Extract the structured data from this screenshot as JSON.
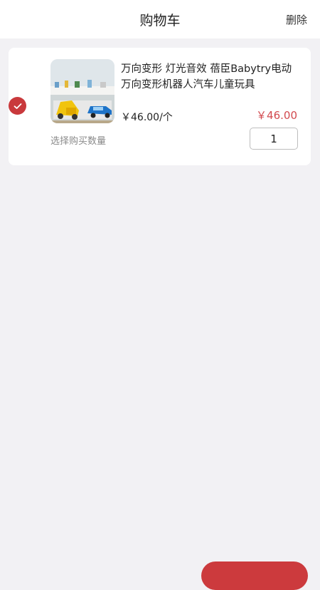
{
  "header": {
    "title": "购物车",
    "delete_label": "删除"
  },
  "cart": {
    "items": [
      {
        "title": "万向变形 灯光音效 蓓臣Babytry电动万向变形机器人汽车儿童玩具",
        "unit_price": "￥46.00/个",
        "total_price": "￥46.00",
        "quantity_label": "选择购买数量",
        "quantity": "1",
        "selected": true
      }
    ]
  },
  "colors": {
    "accent": "#c9393c",
    "price": "#d24a4f",
    "background": "#f2f1f4"
  }
}
